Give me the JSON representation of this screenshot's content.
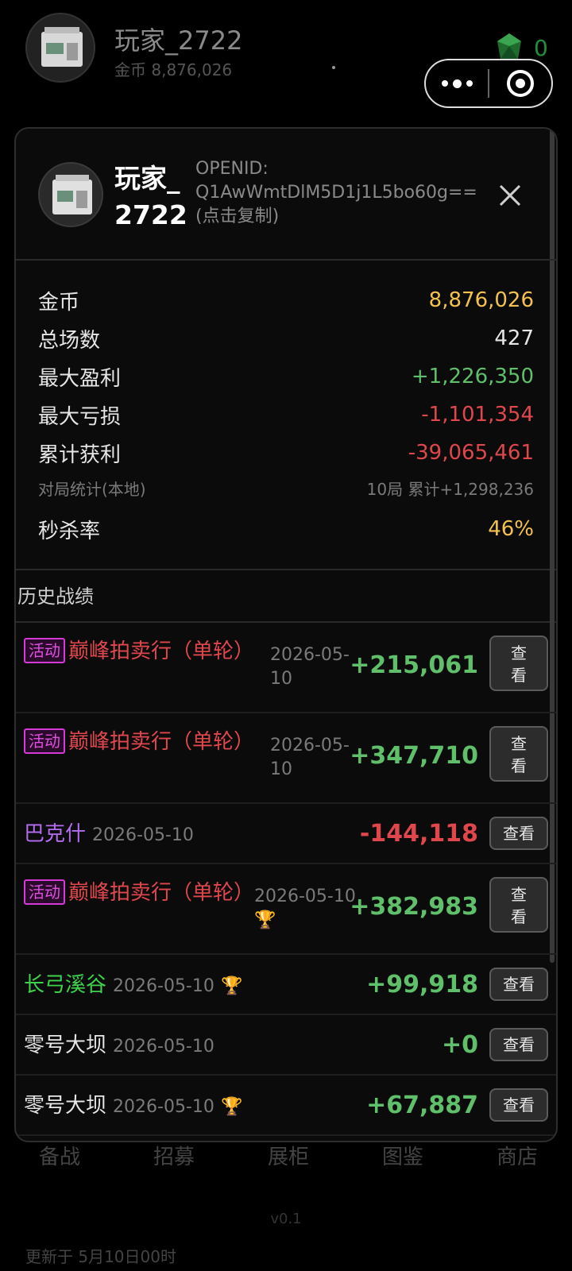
{
  "background": {
    "player_name": "玩家_2722",
    "coins_line": "金币 8,876,026",
    "gem_count": "0",
    "tabs": [
      "备战",
      "招募",
      "展柜",
      "图鉴",
      "商店"
    ],
    "version": "v0.1",
    "update_text": "更新于 5月10日00时"
  },
  "modal": {
    "player_name": "玩家_2722",
    "openid_label": "OPENID:",
    "openid_value": "Q1AwWmtDlM5D1j1L5bo60g==",
    "copy_hint": "(点击复制)",
    "stats": {
      "coins_label": "金币",
      "coins_value": "8,876,026",
      "matches_label": "总场数",
      "matches_value": "427",
      "max_profit_label": "最大盈利",
      "max_profit_value": "+1,226,350",
      "max_loss_label": "最大亏损",
      "max_loss_value": "-1,101,354",
      "total_profit_label": "累计获利",
      "total_profit_value": "-39,065,461",
      "local_label": "对局统计(本地)",
      "local_value": "10局 累计+1,298,236",
      "kill_rate_label": "秒杀率",
      "kill_rate_value": "46%"
    },
    "history_title": "历史战绩",
    "tag_label": "活动",
    "view_label": "查看",
    "records": [
      {
        "title": "巅峰拍卖行（单轮）",
        "date": "2026-05-10",
        "amount": "+215,061"
      },
      {
        "title": "巅峰拍卖行（单轮）",
        "date": "2026-05-10",
        "amount": "+347,710"
      },
      {
        "title": "巴克什",
        "date": "2026-05-10",
        "amount": "-144,118"
      },
      {
        "title": "巅峰拍卖行（单轮）",
        "date": "2026-05-10",
        "amount": "+382,983"
      },
      {
        "title": "长弓溪谷",
        "date": "2026-05-10",
        "amount": "+99,918"
      },
      {
        "title": "零号大坝",
        "date": "2026-05-10",
        "amount": "+0"
      },
      {
        "title": "零号大坝",
        "date": "2026-05-10",
        "amount": "+67,887"
      }
    ]
  },
  "colors": {
    "gold": "#f2c14e",
    "profit": "#5fbf6a",
    "loss": "#e0474c",
    "event_tag": "#d63ad6"
  }
}
